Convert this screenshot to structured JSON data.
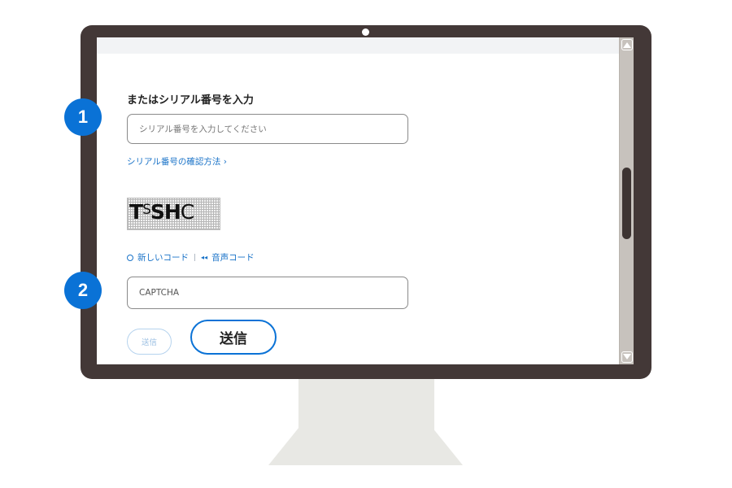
{
  "form": {
    "heading": "またはシリアル番号を入力",
    "serial_placeholder": "シリアル番号を入力してください",
    "how_to_link": "シリアル番号の確認方法 ›",
    "captcha_image_text": "T",
    "captcha_image_text_2": "S",
    "captcha_image_text_3": "SH",
    "captcha_image_text_4": "C",
    "new_code_link": "新しいコード",
    "separator": "|",
    "audio_code_link": "音声コード",
    "captcha_placeholder": "CAPTCHA",
    "submit_small_label": "送信",
    "submit_big_label": "送信"
  },
  "badges": {
    "step1": "1",
    "step2": "2"
  },
  "icons": {
    "refresh": "refresh-icon",
    "audio": "audio-icon"
  },
  "colors": {
    "accent": "#0a72d6",
    "link": "#1a73c8",
    "bezel": "#433837",
    "stand": "#e8e8e4"
  }
}
